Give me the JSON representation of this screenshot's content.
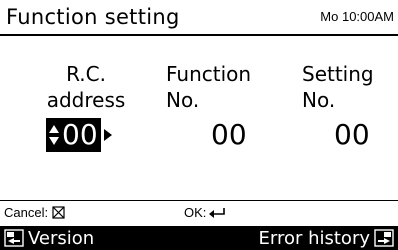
{
  "header": {
    "title": "Function setting",
    "clock": "Mo 10:00AM"
  },
  "columns": {
    "rc_address": {
      "label_line1": "R.C.",
      "label_line2": "address",
      "value": "00"
    },
    "function_no": {
      "label_line1": "Function",
      "label_line2": "No.",
      "value": "00"
    },
    "setting_no": {
      "label_line1": "Setting",
      "label_line2": "No.",
      "value": "00"
    }
  },
  "hints": {
    "cancel": "Cancel:",
    "ok": "OK:"
  },
  "bottom_bar": {
    "left_label": "Version",
    "right_label": "Error history"
  },
  "icons": {
    "cancel": "cancel-box-icon",
    "ok": "enter-icon",
    "left_button": "menu-left-icon",
    "right_button": "menu-right-icon",
    "address_adjust": "up-down-arrow-icon",
    "address_next": "right-arrow-icon"
  },
  "colors": {
    "background": "#ffffff",
    "foreground": "#000000",
    "highlight": "#000000"
  }
}
